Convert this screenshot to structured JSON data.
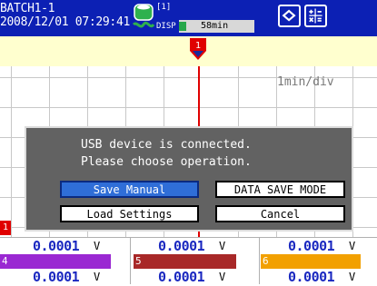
{
  "header": {
    "batch_name": "BATCH1-1",
    "datetime": "2008/12/01 07:29:41",
    "group_tag": "[1]",
    "disp_label": "DISP",
    "time_div": "58min",
    "colors": {
      "bar_bg": "#0c20b4",
      "time_fill": "#27a74a"
    }
  },
  "banner": {
    "marker_number": "1"
  },
  "chart": {
    "scale_label": "1min/div"
  },
  "dialog": {
    "message_line1": "USB device is connected.",
    "message_line2": "Please choose operation.",
    "buttons": {
      "save_manual": "Save Manual",
      "data_save_mode": "DATA SAVE MODE",
      "load_settings": "Load Settings",
      "cancel": "Cancel"
    }
  },
  "channels": {
    "marker_1": "1",
    "row1": [
      {
        "value": "0.0001",
        "unit": "V"
      },
      {
        "value": "0.0001",
        "unit": "V"
      },
      {
        "value": "0.0001",
        "unit": "V"
      }
    ],
    "row2_labels": [
      "4",
      "5",
      "6"
    ],
    "row2_colors": [
      "#9a28d2",
      "#a82828",
      "#f2a000"
    ],
    "row2": [
      {
        "value": "0.0001",
        "unit": "V"
      },
      {
        "value": "0.0001",
        "unit": "V"
      },
      {
        "value": "0.0001",
        "unit": "V"
      }
    ]
  }
}
